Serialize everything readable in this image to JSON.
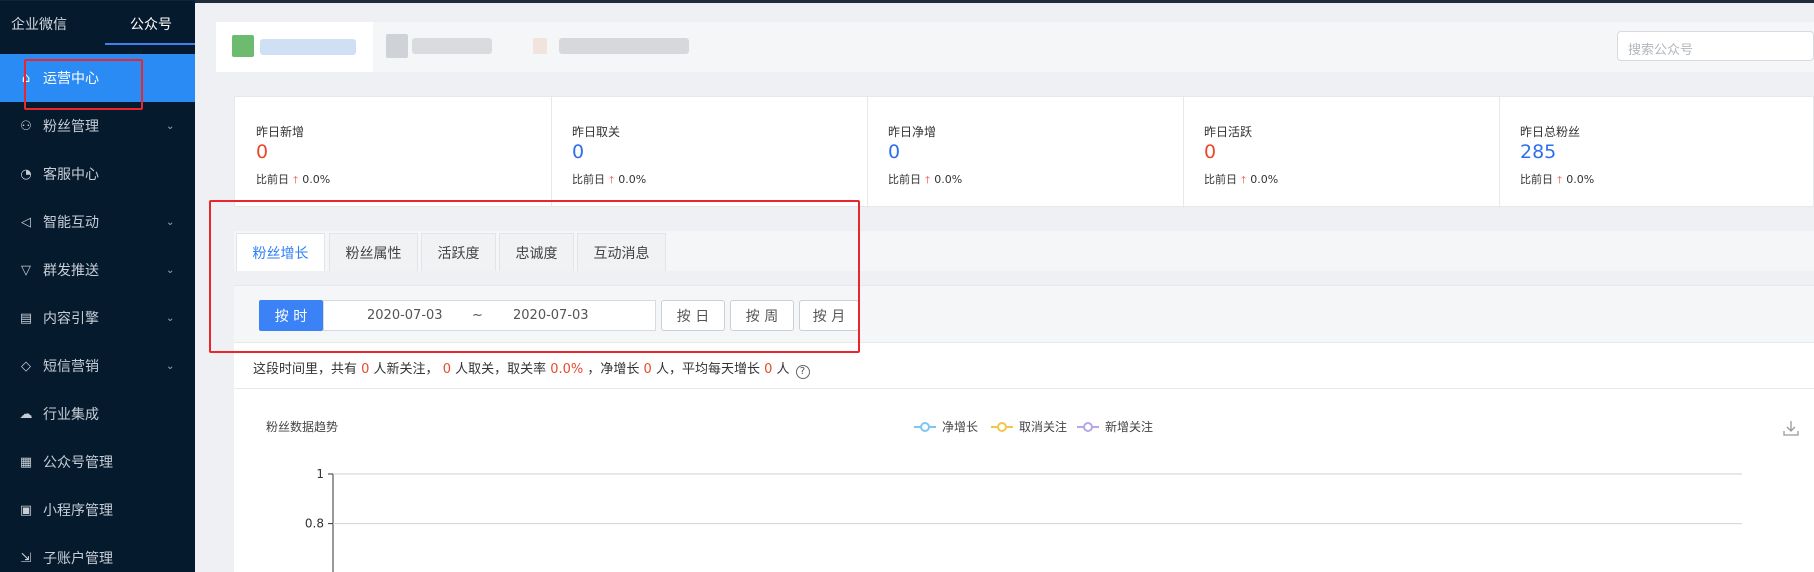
{
  "sidebar": {
    "tabs": [
      "企业微信",
      "公众号"
    ],
    "items": [
      {
        "label": "运营中心",
        "icon": "home-icon",
        "has_caret": false
      },
      {
        "label": "粉丝管理",
        "icon": "users-icon",
        "has_caret": true
      },
      {
        "label": "客服中心",
        "icon": "chat-icon",
        "has_caret": false
      },
      {
        "label": "智能互动",
        "icon": "megaphone-icon",
        "has_caret": true
      },
      {
        "label": "群发推送",
        "icon": "funnel-icon",
        "has_caret": true
      },
      {
        "label": "内容引擎",
        "icon": "document-icon",
        "has_caret": true
      },
      {
        "label": "短信营销",
        "icon": "tag-icon",
        "has_caret": true
      },
      {
        "label": "行业集成",
        "icon": "cloud-icon",
        "has_caret": false
      },
      {
        "label": "公众号管理",
        "icon": "grid-icon",
        "has_caret": false
      },
      {
        "label": "小程序管理",
        "icon": "lock-icon",
        "has_caret": false
      },
      {
        "label": "子账户管理",
        "icon": "logout-icon",
        "has_caret": false
      }
    ]
  },
  "header": {
    "search_placeholder": "搜索公众号"
  },
  "stats": [
    {
      "title": "昨日新增",
      "value": "0",
      "value_color": "#e64a2e",
      "compare_label": "比前日",
      "change": "0.0%"
    },
    {
      "title": "昨日取关",
      "value": "0",
      "value_color": "#2d6ff0",
      "compare_label": "比前日",
      "change": "0.0%"
    },
    {
      "title": "昨日净增",
      "value": "0",
      "value_color": "#2d6ff0",
      "compare_label": "比前日",
      "change": "0.0%"
    },
    {
      "title": "昨日活跃",
      "value": "0",
      "value_color": "#e64a2e",
      "compare_label": "比前日",
      "change": "0.0%"
    },
    {
      "title": "昨日总粉丝",
      "value": "285",
      "value_color": "#2d6ff0",
      "compare_label": "比前日",
      "change": "0.0%"
    }
  ],
  "tabs": [
    "粉丝增长",
    "粉丝属性",
    "活跃度",
    "忠诚度",
    "互动消息"
  ],
  "filter": {
    "by_hour": "按 时",
    "start_date": "2020-07-03",
    "separator": "~",
    "end_date": "2020-07-03",
    "by_day": "按 日",
    "by_week": "按 周",
    "by_month": "按 月"
  },
  "summary": {
    "p1": "这段时间里，共有 ",
    "new_follow": "0",
    "p2": " 人新关注， ",
    "unfollow": "0",
    "p3": " 人取关，取关率 ",
    "unfollow_rate": "0.0%",
    "p4": " ，净增长 ",
    "net_growth": "0",
    "p5": " 人，平均每天增长 ",
    "avg_daily": "0",
    "p6": " 人"
  },
  "chart_data": {
    "type": "line",
    "title": "粉丝数据趋势",
    "series": [
      {
        "name": "净增长",
        "color": "#7cc7f2",
        "values": []
      },
      {
        "name": "取消关注",
        "color": "#f3c64b",
        "values": []
      },
      {
        "name": "新增关注",
        "color": "#b6a6e6",
        "values": []
      }
    ],
    "y_ticks": [
      "1",
      "0.8"
    ],
    "ylim": [
      0,
      1
    ],
    "grid": true,
    "legend_position": "top-center"
  }
}
